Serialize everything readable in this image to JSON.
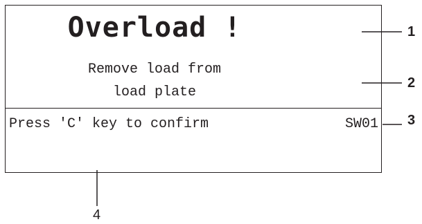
{
  "display": {
    "title": "Overload !",
    "message_line1": "Remove load from",
    "message_line2": "load plate",
    "confirm_text": "Press 'C' key to confirm",
    "code": "SW01"
  },
  "callouts": {
    "one": "1",
    "two": "2",
    "three": "3",
    "four": "4"
  },
  "colors": {
    "ink": "#231f20",
    "background": "#ffffff"
  }
}
